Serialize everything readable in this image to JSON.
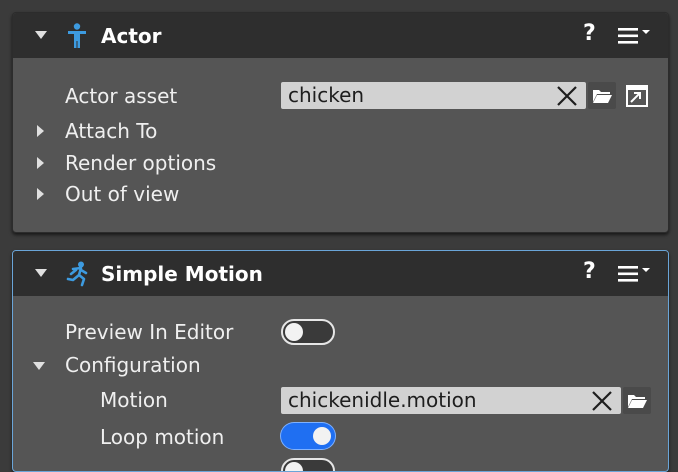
{
  "actor": {
    "title": "Actor",
    "help": "?",
    "icon": "person-icon",
    "rows": {
      "actor_asset": {
        "label": "Actor asset",
        "value": "chicken"
      },
      "attach_to": "Attach To",
      "render_options": "Render options",
      "out_of_view": "Out of view"
    }
  },
  "simple_motion": {
    "title": "Simple Motion",
    "help": "?",
    "icon": "running-person-icon",
    "rows": {
      "preview": {
        "label": "Preview In Editor",
        "value": false
      },
      "configuration": "Configuration",
      "motion": {
        "label": "Motion",
        "value": "chickenidle.motion"
      },
      "loop": {
        "label": "Loop motion",
        "value": true
      }
    }
  },
  "colors": {
    "accent": "#1f6ff2",
    "selected_border": "#6aa5d8",
    "header_bg": "#2e2e2e",
    "panel_bg": "#555555"
  }
}
